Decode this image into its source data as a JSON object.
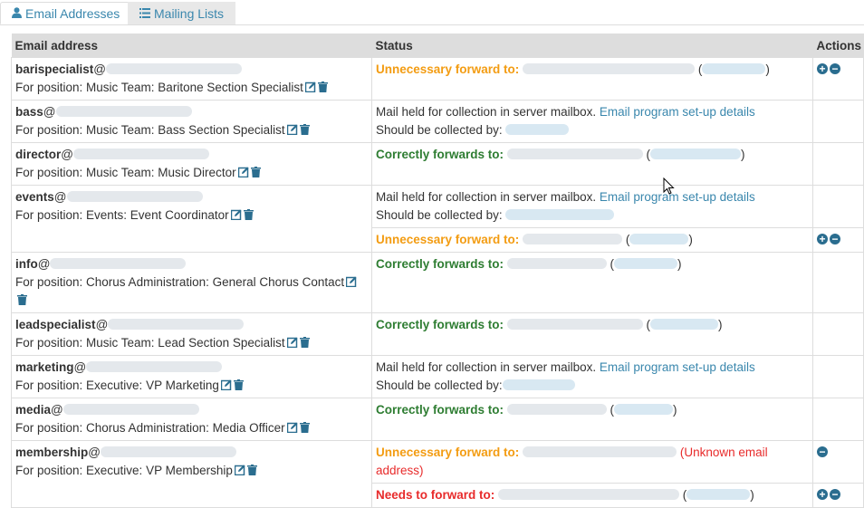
{
  "tabs": [
    {
      "label": "Email Addresses",
      "icon": "user-icon",
      "active": true
    },
    {
      "label": "Mailing Lists",
      "icon": "list-icon",
      "active": false
    }
  ],
  "table": {
    "headers": [
      "Email address",
      "Status",
      "Actions"
    ],
    "labels": {
      "unnecessary_forward": "Unnecessary forward to:",
      "correctly_forwards": "Correctly forwards to:",
      "needs_forward": "Needs to forward to:",
      "mail_held": "Mail held for collection in server mailbox.",
      "setup_link": "Email program set-up details",
      "collected_by": "Should be collected by:",
      "unknown_email": "(Unknown email address)"
    },
    "rows": [
      {
        "address": "barispecialist",
        "position": "For position: Music Team: Baritone Section Specialist"
      },
      {
        "address": "bass",
        "position": "For position: Music Team: Bass Section Specialist"
      },
      {
        "address": "director",
        "position": "For position: Music Team: Music Director"
      },
      {
        "address": "events",
        "position": "For position: Events: Event Coordinator"
      },
      {
        "address": "info",
        "position": "For position: Chorus Administration: General Chorus Contact"
      },
      {
        "address": "leadspecialist",
        "position": "For position: Music Team: Lead Section Specialist"
      },
      {
        "address": "marketing",
        "position": "For position: Executive: VP Marketing"
      },
      {
        "address": "media",
        "position": "For position: Chorus Administration: Media Officer"
      },
      {
        "address": "membership",
        "position": "For position: Executive: VP Membership"
      }
    ]
  },
  "colors": {
    "link": "#3a87ad",
    "orange": "#f39c12",
    "green": "#2e7d32",
    "red": "#e82b2b"
  }
}
